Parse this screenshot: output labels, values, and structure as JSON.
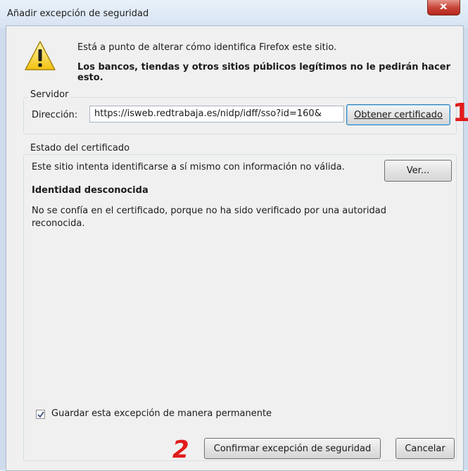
{
  "window": {
    "title": "Añadir excepción de seguridad",
    "close_symbol": "x"
  },
  "warning": {
    "line1": "Está a punto de alterar cómo identifica Firefox este sitio.",
    "line2": "Los bancos, tiendas y otros sitios públicos legítimos no le pedirán hacer esto."
  },
  "server": {
    "legend": "Servidor",
    "address_label": "Dirección:",
    "address_value": "https://isweb.redtrabaja.es/nidp/idff/sso?id=160&",
    "get_cert_label": "Obtener certificado"
  },
  "cert_status": {
    "legend": "Estado del certificado",
    "status_text": "Este sitio intenta identificarse a sí mismo con información no válida.",
    "view_label": "Ver...",
    "identity_heading": "Identidad desconocida",
    "description": "No se confía en el certificado, porque no ha sido verificado por una autoridad reconocida."
  },
  "permanent": {
    "checked": true,
    "label": "Guardar esta excepción de manera permanente"
  },
  "buttons": {
    "confirm_label": "Confirmar excepción de seguridad",
    "cancel_label": "Cancelar"
  },
  "annotations": {
    "marker_1": "1",
    "marker_2": "2"
  },
  "icons": {
    "warning": "warning-triangle-icon",
    "checkbox": "check-icon"
  },
  "colors": {
    "accent_marker": "#e11b1b",
    "close_button": "#c9463a"
  }
}
